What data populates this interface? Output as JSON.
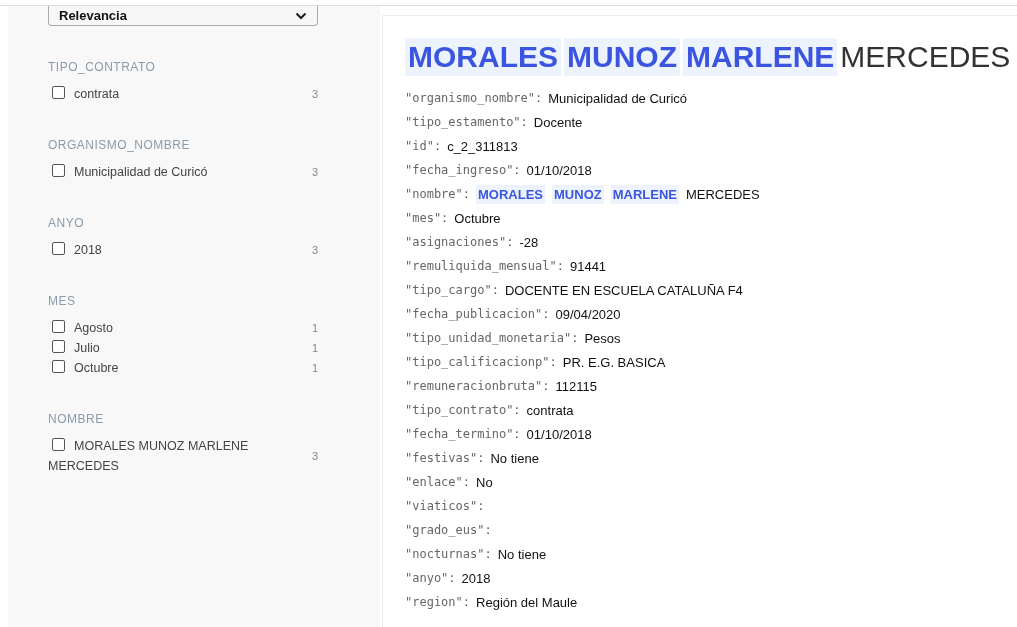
{
  "sort_select": {
    "value": "Relevancia"
  },
  "facets": [
    {
      "title": "TIPO_CONTRATO",
      "options": [
        {
          "label": "contrata",
          "count": "3",
          "checked": false
        }
      ]
    },
    {
      "title": "ORGANISMO_NOMBRE",
      "options": [
        {
          "label": "Municipalidad de Curicó",
          "count": "3",
          "checked": false
        }
      ]
    },
    {
      "title": "ANYO",
      "options": [
        {
          "label": "2018",
          "count": "3",
          "checked": false
        }
      ]
    },
    {
      "title": "MES",
      "options": [
        {
          "label": "Agosto",
          "count": "1",
          "checked": false
        },
        {
          "label": "Julio",
          "count": "1",
          "checked": false
        },
        {
          "label": "Octubre",
          "count": "1",
          "checked": false
        }
      ]
    },
    {
      "title": "NOMBRE",
      "options": [
        {
          "label": "MORALES MUNOZ MARLENE MERCEDES",
          "count": "3",
          "checked": false
        }
      ]
    }
  ],
  "result": {
    "title": [
      {
        "text": "MORALES",
        "highlighted": true
      },
      {
        "text": "MUNOZ",
        "highlighted": true
      },
      {
        "text": "MARLENE",
        "highlighted": true
      },
      {
        "text": "MERCEDES",
        "highlighted": false
      }
    ],
    "fields": [
      {
        "key": "\"organismo_nombre\":",
        "value": "Municipalidad de Curicó"
      },
      {
        "key": "\"tipo_estamento\":",
        "value": "Docente"
      },
      {
        "key": "\"id\":",
        "value": "c_2_311813"
      },
      {
        "key": "\"fecha_ingreso\":",
        "value": "01/10/2018"
      },
      {
        "key": "\"nombre\":",
        "value_parts": [
          {
            "text": "MORALES",
            "highlighted": true
          },
          {
            "text": "MUNOZ",
            "highlighted": true
          },
          {
            "text": "MARLENE",
            "highlighted": true
          },
          {
            "text": "MERCEDES",
            "highlighted": false
          }
        ]
      },
      {
        "key": "\"mes\":",
        "value": "Octubre"
      },
      {
        "key": "\"asignaciones\":",
        "value": "-28"
      },
      {
        "key": "\"remuliquida_mensual\":",
        "value": "91441"
      },
      {
        "key": "\"tipo_cargo\":",
        "value": "DOCENTE EN ESCUELA CATALUÑA F4"
      },
      {
        "key": "\"fecha_publicacion\":",
        "value": "09/04/2020"
      },
      {
        "key": "\"tipo_unidad_monetaria\":",
        "value": "Pesos"
      },
      {
        "key": "\"tipo_calificacionp\":",
        "value": "PR. E.G. BASICA"
      },
      {
        "key": "\"remuneracionbruta\":",
        "value": "112115"
      },
      {
        "key": "\"tipo_contrato\":",
        "value": "contrata"
      },
      {
        "key": "\"fecha_termino\":",
        "value": "01/10/2018"
      },
      {
        "key": "\"festivas\":",
        "value": "No tiene"
      },
      {
        "key": "\"enlace\":",
        "value": "No"
      },
      {
        "key": "\"viaticos\":"
      },
      {
        "key": "\"grado_eus\":"
      },
      {
        "key": "\"nocturnas\":",
        "value": "No tiene"
      },
      {
        "key": "\"anyo\":",
        "value": "2018"
      },
      {
        "key": "\"region\":",
        "value": "Región del Maule"
      }
    ]
  }
}
